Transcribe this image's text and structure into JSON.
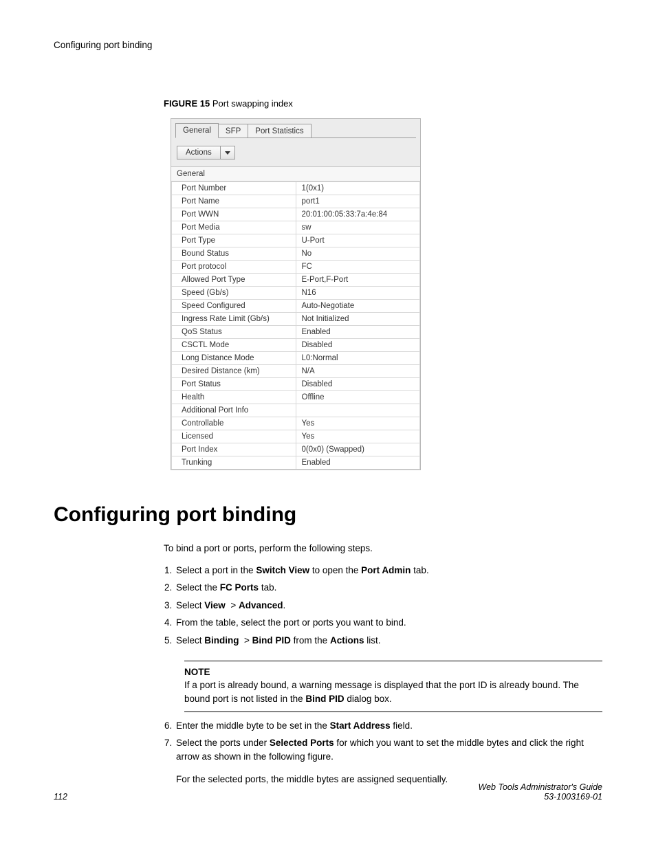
{
  "header": {
    "title": "Configuring port binding"
  },
  "figure": {
    "label": "FIGURE 15",
    "caption": "Port swapping index"
  },
  "tabs": [
    "General",
    "SFP",
    "Port Statistics"
  ],
  "actions_label": "Actions",
  "group_header": "General",
  "props": [
    {
      "label": "Port Number",
      "value": "1(0x1)"
    },
    {
      "label": "Port Name",
      "value": "port1"
    },
    {
      "label": "Port WWN",
      "value": "20:01:00:05:33:7a:4e:84"
    },
    {
      "label": "Port Media",
      "value": "sw"
    },
    {
      "label": "Port Type",
      "value": "U-Port"
    },
    {
      "label": "Bound Status",
      "value": "No"
    },
    {
      "label": "Port protocol",
      "value": "FC"
    },
    {
      "label": "Allowed Port Type",
      "value": "E-Port,F-Port"
    },
    {
      "label": "Speed (Gb/s)",
      "value": "N16"
    },
    {
      "label": "Speed Configured",
      "value": "Auto-Negotiate"
    },
    {
      "label": "Ingress Rate Limit (Gb/s)",
      "value": "Not Initialized"
    },
    {
      "label": "QoS Status",
      "value": "Enabled"
    },
    {
      "label": "CSCTL Mode",
      "value": "Disabled"
    },
    {
      "label": "Long Distance Mode",
      "value": "L0:Normal"
    },
    {
      "label": "Desired Distance (km)",
      "value": "N/A"
    },
    {
      "label": "Port Status",
      "value": "Disabled"
    },
    {
      "label": "Health",
      "value": "Offline"
    },
    {
      "label": "Additional Port Info",
      "value": ""
    },
    {
      "label": "Controllable",
      "value": "Yes"
    },
    {
      "label": "Licensed",
      "value": "Yes"
    },
    {
      "label": "Port Index",
      "value": "0(0x0) (Swapped)"
    },
    {
      "label": "Trunking",
      "value": "Enabled"
    }
  ],
  "section": {
    "heading": "Configuring port binding",
    "intro": "To bind a port or ports, perform the following steps.",
    "step1_a": "Select a port in the ",
    "step1_b": "Switch View",
    "step1_c": " to open the ",
    "step1_d": "Port Admin",
    "step1_e": " tab.",
    "step2_a": "Select the ",
    "step2_b": "FC Ports",
    "step2_c": " tab.",
    "step3_a": "Select ",
    "step3_b": "View",
    "step3_c": "Advanced",
    "step4": "From the table, select the port or ports you want to bind.",
    "step5_a": "Select ",
    "step5_b": "Binding",
    "step5_c": "Bind PID",
    "step5_d": " from the ",
    "step5_e": "Actions",
    "step5_f": " list.",
    "note_title": "NOTE",
    "note_a": "If a port is already bound, a warning message is displayed that the port ID is already bound. The bound port is not listed in the ",
    "note_b": "Bind PID",
    "note_c": " dialog box.",
    "step6_a": "Enter the middle byte to be set in the ",
    "step6_b": "Start Address",
    "step6_c": " field.",
    "step7_a": "Select the ports under ",
    "step7_b": "Selected Ports",
    "step7_c": " for which you want to set the middle bytes and click the right arrow as shown in the following figure.",
    "step7_p2": "For the selected ports, the middle bytes are assigned sequentially."
  },
  "footer": {
    "page": "112",
    "guide": "Web Tools Administrator's Guide",
    "docnum": "53-1003169-01"
  }
}
